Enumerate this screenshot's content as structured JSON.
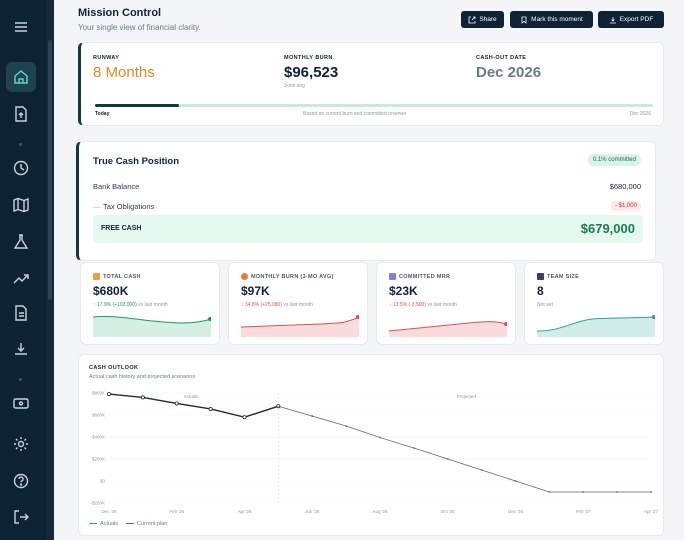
{
  "header": {
    "title": "Mission Control",
    "subtitle": "Your single view of financial clarity.",
    "buttons": {
      "share": "Share",
      "mark": "Mark this moment",
      "export": "Export PDF"
    }
  },
  "runway": {
    "runway_label": "RUNWAY",
    "runway_value": "8 Months",
    "burn_label": "MONTHLY BURN",
    "burn_value": "$96,523",
    "burn_note": "3-mo avg",
    "cashout_label": "CASH-OUT DATE",
    "cashout_value": "Dec 2026",
    "progress": 0.15,
    "foot_left": "Today",
    "foot_mid": "Based on current burn and committed revenue",
    "foot_right": "Dec 2026"
  },
  "cash_position": {
    "title": "True Cash Position",
    "badge": "0.1% committed",
    "bank_label": "Bank Balance",
    "bank_value": "$680,000",
    "tax_label": "Tax Obligations",
    "tax_prefix": "—",
    "tax_value": "- $1,000",
    "free_label": "FREE CASH",
    "free_value": "$679,000"
  },
  "kpis": [
    {
      "label": "TOTAL CASH",
      "value": "$680K",
      "delta": "↑ 17.9% (+103,000)",
      "suffix": "vs last month",
      "trend": "up",
      "color": "#1a9a66",
      "icon": "money-bag-icon"
    },
    {
      "label": "MONTHLY BURN (3-MO AVG)",
      "value": "$97K",
      "delta": "↑ 34.8% (+25,080)",
      "suffix": "vs last month",
      "trend": "down",
      "color": "#e05050",
      "icon": "fire-icon"
    },
    {
      "label": "COMMITTED MRR",
      "value": "$23K",
      "delta": "↓ 13.5% (-3,500)",
      "suffix": "vs last month",
      "trend": "down",
      "color": "#e05050",
      "icon": "chart-icon"
    },
    {
      "label": "TEAM SIZE",
      "value": "8",
      "delta": "",
      "suffix": "Not set",
      "trend": "none",
      "color": "#2aa394",
      "icon": "people-icon"
    }
  ],
  "chart_data": {
    "type": "line",
    "title": "CASH OUTLOOK",
    "subtitle": "Actual cash history and projected scenarios",
    "annotations": [
      "Actuals",
      "Projected"
    ],
    "x_ticks": [
      "Dec '25",
      "Feb '26",
      "Apr '26",
      "Jun '26",
      "Aug '26",
      "Oct '26",
      "Dec '26",
      "Feb '27",
      "Apr '27"
    ],
    "y_ticks": [
      "$800K",
      "$600K",
      "$400K",
      "$200K",
      "$0",
      "-$200K"
    ],
    "ylim": [
      -200,
      800
    ],
    "series": [
      {
        "name": "Actuals",
        "color": "#1b2a4a",
        "x": [
          0,
          0.5,
          1,
          1.5,
          2,
          2.5
        ],
        "y": [
          790,
          760,
          705,
          655,
          580,
          680
        ]
      },
      {
        "name": "Current plan",
        "color": "#666666",
        "x": [
          2.5,
          3,
          3.5,
          4,
          4.5,
          5,
          5.5,
          6,
          6.5,
          7,
          7.5,
          8
        ],
        "y": [
          680,
          590,
          500,
          395,
          300,
          200,
          100,
          0,
          -100,
          -100,
          -100,
          -100
        ]
      }
    ],
    "legend": [
      "Actuals",
      "Current plan"
    ]
  }
}
